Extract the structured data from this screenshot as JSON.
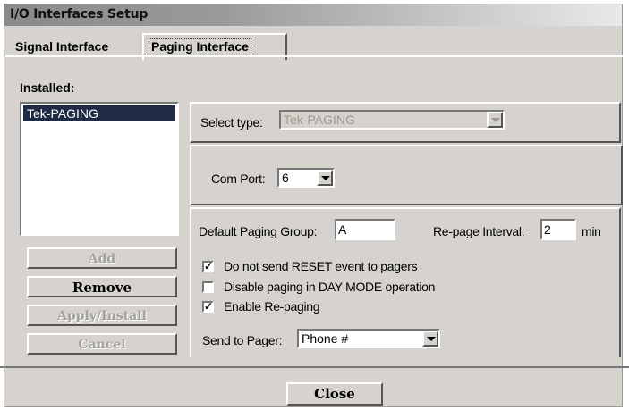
{
  "window": {
    "title": "I/O Interfaces Setup",
    "close_label": "Close"
  },
  "tabs": [
    {
      "label": "Signal Interface",
      "active": false
    },
    {
      "label": "Paging Interface",
      "active": true
    }
  ],
  "installed": {
    "label": "Installed:",
    "items": [
      {
        "label": "Tek-PAGING",
        "selected": true
      }
    ]
  },
  "buttons": {
    "add": "Add",
    "remove": "Remove",
    "apply_install": "Apply/Install",
    "cancel": "Cancel"
  },
  "settings": {
    "select_type_label": "Select type:",
    "select_type_value": "Tek-PAGING",
    "com_port_label": "Com Port:",
    "com_port_value": "6",
    "default_paging_group_label": "Default Paging Group:",
    "default_paging_group_value": "A",
    "repage_interval_label": "Re-page Interval:",
    "repage_interval_value": "2",
    "repage_interval_unit": "min",
    "checkboxes": [
      {
        "label": "Do not send RESET event to pagers",
        "checked": true,
        "mark": "✓"
      },
      {
        "label": "Disable paging in DAY MODE operation",
        "checked": false,
        "mark": ""
      },
      {
        "label": "Enable Re-paging",
        "checked": true,
        "mark": "✓"
      }
    ],
    "send_to_pager_label": "Send to Pager:",
    "send_to_pager_value": "Phone #"
  },
  "colors": {
    "dialog_bg": "#d6d3ce",
    "selection_bg": "#1f2a44"
  }
}
